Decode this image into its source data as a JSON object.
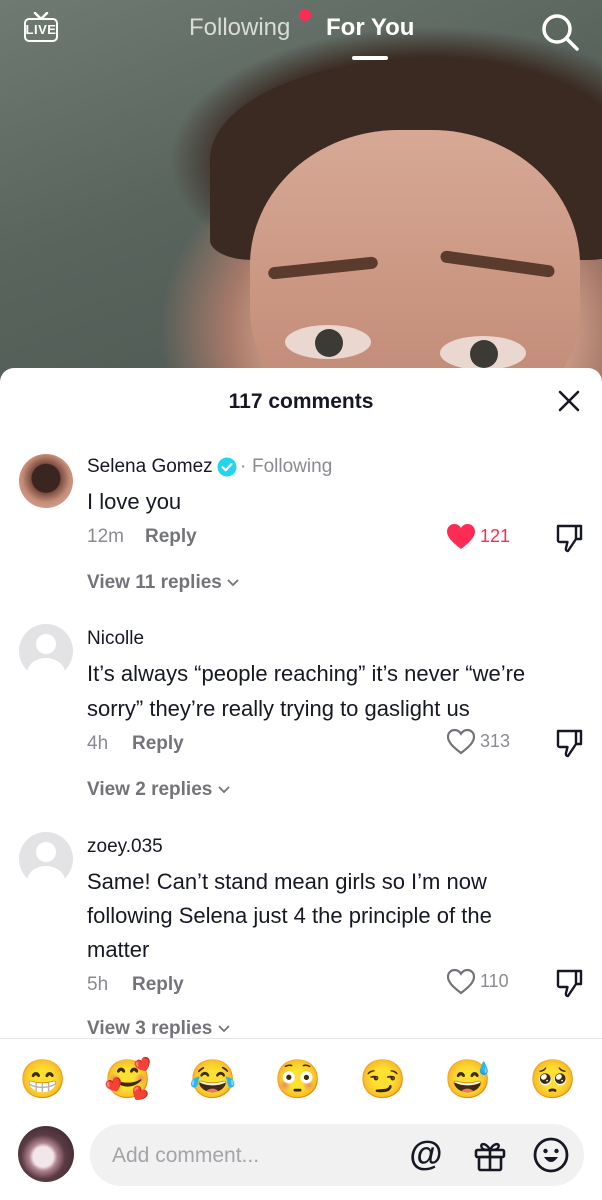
{
  "header": {
    "live_label": "LIVE",
    "tabs": [
      {
        "label": "Following",
        "active": false,
        "has_notification_dot": true
      },
      {
        "label": "For You",
        "active": true
      }
    ],
    "icons": [
      "live-icon",
      "search-icon"
    ]
  },
  "comments_panel": {
    "count_label": "117 comments",
    "comments": [
      {
        "username": "Selena Gomez",
        "verified": true,
        "following_label": "Following",
        "text": "I love you",
        "time": "12m",
        "reply_label": "Reply",
        "likes": "121",
        "liked": true,
        "view_replies": "View 11 replies"
      },
      {
        "username": "Nicolle",
        "text_lines": [
          "It’s always “people reaching” it’s never “we’re",
          "sorry” they’re really trying to gaslight us"
        ],
        "time": "4h",
        "reply_label": "Reply",
        "likes": "313",
        "liked": false,
        "view_replies": "View 2 replies"
      },
      {
        "username": "zoey.035",
        "text_lines": [
          "Same! Can’t stand mean girls so I’m now",
          "following Selena just 4 the principle of the",
          "matter"
        ],
        "time": "5h",
        "reply_label": "Reply",
        "likes": "110",
        "liked": false,
        "view_replies": "View 3 replies"
      }
    ],
    "emoji_bar": [
      "😁",
      "🥰",
      "😂",
      "😳",
      "😏",
      "😅",
      "🥺"
    ],
    "input": {
      "placeholder": "Add comment...",
      "icons": [
        "at-mention-icon",
        "gift-icon",
        "emoji-icon"
      ]
    }
  },
  "colors": {
    "accent_red": "#fe2c55",
    "verified_blue": "#20d5ec",
    "text_primary": "#161823",
    "text_secondary": "#8a8b91"
  }
}
